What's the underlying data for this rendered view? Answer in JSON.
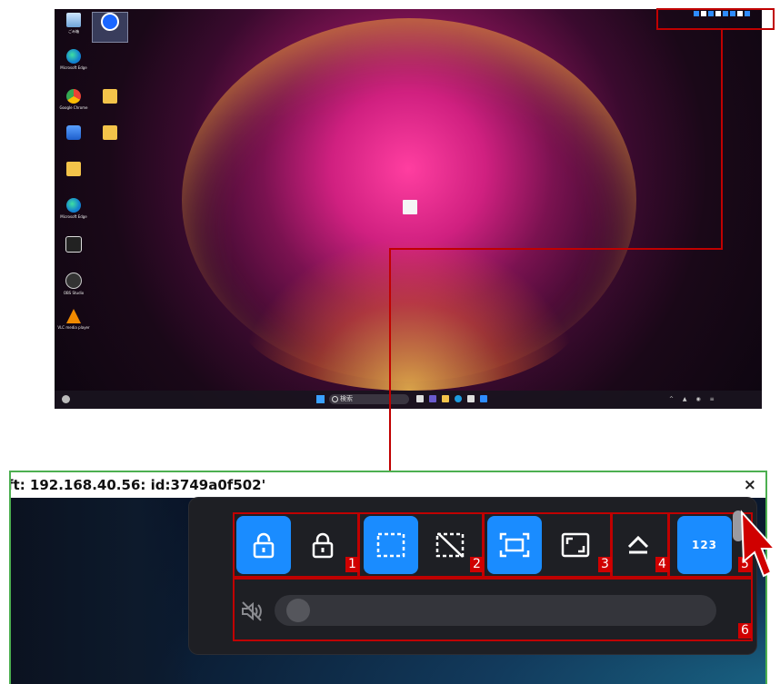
{
  "desktop": {
    "icons": [
      {
        "name": "recycle-bin",
        "label": "ごみ箱",
        "kind": "recycle"
      },
      {
        "name": "teamviewer",
        "label": "",
        "kind": "tv"
      },
      {
        "name": "edge",
        "label": "Microsoft Edge",
        "kind": "edge"
      },
      {
        "name": "chrome",
        "label": "Google Chrome",
        "kind": "chrome"
      },
      {
        "name": "folder-1",
        "label": "",
        "kind": "folder"
      },
      {
        "name": "app",
        "label": "",
        "kind": "app"
      },
      {
        "name": "folder-2",
        "label": "",
        "kind": "folder"
      },
      {
        "name": "folder-3",
        "label": "",
        "kind": "folder"
      },
      {
        "name": "edge-2",
        "label": "Microsoft Edge",
        "kind": "edge"
      },
      {
        "name": "logitech",
        "label": "",
        "kind": "logi"
      },
      {
        "name": "obs",
        "label": "OBS Studio",
        "kind": "obs"
      },
      {
        "name": "vlc",
        "label": "VLC media player",
        "kind": "vlc"
      },
      {
        "name": "text-file",
        "label": "",
        "kind": "file"
      }
    ],
    "taskbar": {
      "search_placeholder": "検索"
    }
  },
  "panel": {
    "title": "ft: 192.168.40.56: id:3749a0f502'",
    "close_glyph": "×"
  },
  "toolbar": {
    "buttons": [
      {
        "name": "lock-on-button",
        "icon": "lock-open-icon",
        "active": true
      },
      {
        "name": "lock-off-button",
        "icon": "lock-icon",
        "active": false
      },
      {
        "name": "select-area-button",
        "icon": "dashed-rect-icon",
        "active": true
      },
      {
        "name": "no-select-area-button",
        "icon": "dashed-rect-slash-icon",
        "active": false
      },
      {
        "name": "fit-screen-button",
        "icon": "fit-screen-icon",
        "active": true
      },
      {
        "name": "original-size-button",
        "icon": "corners-icon",
        "active": false
      },
      {
        "name": "eject-button",
        "icon": "eject-icon",
        "active": false
      },
      {
        "name": "keyboard-numbers-button",
        "icon": "numbers-icon",
        "active": true
      }
    ],
    "numbers_label": "123",
    "group_numbers": [
      "1",
      "2",
      "3",
      "4",
      "5",
      "6"
    ],
    "volume_muted": true,
    "volume_level": 0
  },
  "colors": {
    "accent": "#1a8cff",
    "callout": "#c00000",
    "frame": "#4caf50"
  }
}
